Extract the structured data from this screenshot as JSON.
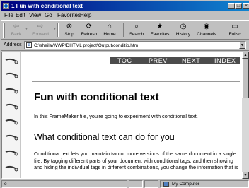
{
  "window": {
    "title": "1 Fun with conditional text"
  },
  "menu": [
    "File",
    "Edit",
    "View",
    "Go",
    "Favorites",
    "Help"
  ],
  "toolbar": {
    "buttons": [
      {
        "label": "Back",
        "icon": "back-arrow-icon"
      },
      {
        "label": "Forward",
        "icon": "forward-arrow-icon"
      },
      {
        "label": "Stop",
        "icon": "stop-icon"
      },
      {
        "label": "Refresh",
        "icon": "refresh-icon"
      },
      {
        "label": "Home",
        "icon": "home-icon"
      },
      {
        "label": "Search",
        "icon": "search-icon"
      },
      {
        "label": "Favorites",
        "icon": "favorites-icon"
      },
      {
        "label": "History",
        "icon": "history-icon"
      },
      {
        "label": "Channels",
        "icon": "channels-icon"
      },
      {
        "label": "Fullsc",
        "icon": "fullscreen-icon"
      }
    ]
  },
  "address": {
    "label": "Address",
    "url": "C:\\sheila\\WWP\\DHTML project\\Output\\conditio.htm"
  },
  "page": {
    "nav": [
      "TOC",
      "PREV",
      "NEXT",
      "INDEX"
    ],
    "heading": "Fun with conditional text",
    "intro": "In this FrameMaker file, you're going to experiment with conditional text.",
    "subheading": "What conditional text can do for you",
    "body": "Conditional text lets you maintain two or more versions of the same document in a single file. By tagging different parts of your document with conditional tags, and then showing and hiding the individual tags in different combinations, you change the information that is"
  },
  "status": {
    "zone": "My Computer"
  },
  "colors": {
    "titlebar": "#000080",
    "navbar": "#4c4c4c",
    "chrome": "#c0c0c0"
  }
}
